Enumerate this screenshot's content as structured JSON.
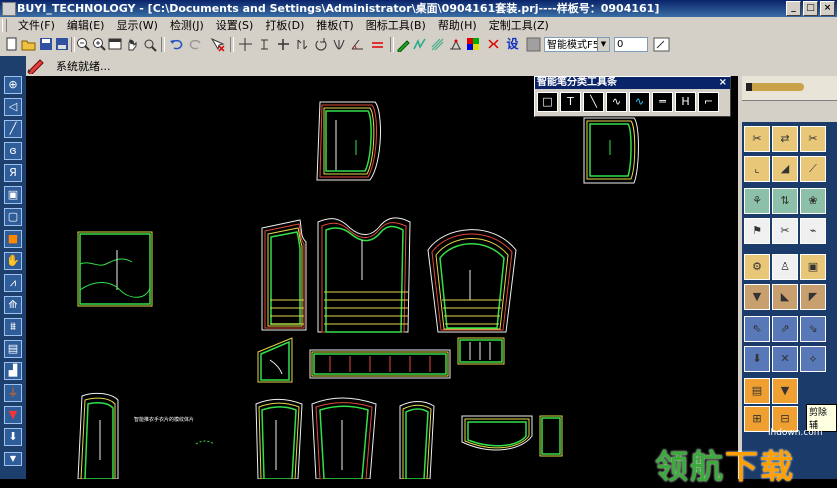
{
  "window": {
    "title": "BUYI_TECHNOLOGY - [C:\\Documents and Settings\\Administrator\\桌面\\0904161套装.prj----样板号：0904161]",
    "controls": [
      "_",
      "□",
      "×"
    ]
  },
  "menu": {
    "items": [
      "文件(F)",
      "编辑(E)",
      "显示(W)",
      "检测(J)",
      "设置(S)",
      "打板(D)",
      "推板(T)",
      "图标工具(B)",
      "帮助(H)",
      "定制工具(Z)"
    ]
  },
  "toolbar": {
    "mode_select": "智能模式F5",
    "value_input": "0",
    "setting_label": "设"
  },
  "status": {
    "text": "系统就绪..."
  },
  "floating_toolbar": {
    "title": "智能笔分类工具条",
    "close": "×"
  },
  "canvas": {
    "annotation": "智能推衣手衣片的模纹体片"
  },
  "right_panel": {
    "partial_label": "剪除辅"
  },
  "watermark": {
    "url": "lhdown.com",
    "text": "领航下载",
    "text_main": "领航",
    "text_accent": "下载"
  },
  "colors": {
    "outline_green": "#33e04a",
    "grade_yellow": "#e6d84a",
    "grade_red": "#e04a3a",
    "grade_white": "#f0f0f0",
    "canvas_bg": "#000000"
  }
}
